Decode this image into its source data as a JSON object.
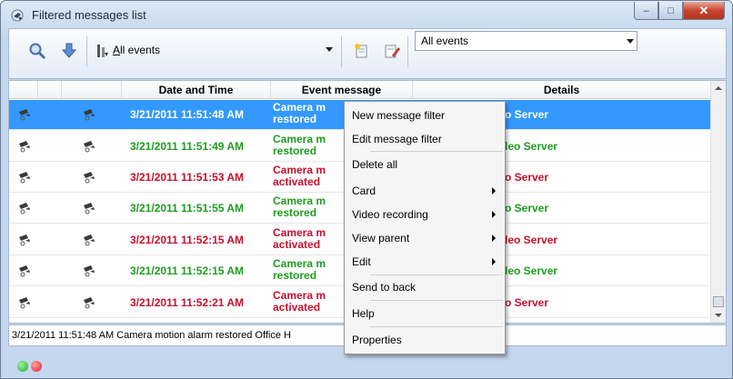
{
  "window": {
    "title": "Filtered messages list",
    "minimize_glyph": "–",
    "maximize_glyph": "□",
    "close_glyph": "✕"
  },
  "toolbar": {
    "events_filter_label_prefix": "",
    "events_filter_label_underlined": "A",
    "events_filter_label_rest": "ll events",
    "combo_value": "All events"
  },
  "grid": {
    "columns": [
      "",
      "",
      "",
      "Date and Time",
      "Event message",
      "Details"
    ],
    "rows": [
      {
        "datetime": "3/21/2011 11:51:48 AM",
        "message_line1": "Camera m",
        "message_line2": "restored",
        "details": "o Server",
        "status": "green",
        "selected": true
      },
      {
        "datetime": "3/21/2011 11:51:49 AM",
        "message_line1": "Camera m",
        "message_line2": "restored",
        "details": "leo Server",
        "status": "green",
        "selected": false
      },
      {
        "datetime": "3/21/2011 11:51:53 AM",
        "message_line1": "Camera m",
        "message_line2": "activated",
        "details": "o Server",
        "status": "red",
        "selected": false
      },
      {
        "datetime": "3/21/2011 11:51:55 AM",
        "message_line1": "Camera m",
        "message_line2": "restored",
        "details": "o Server",
        "status": "green",
        "selected": false
      },
      {
        "datetime": "3/21/2011 11:52:15 AM",
        "message_line1": "Camera m",
        "message_line2": "activated",
        "details": "leo Server",
        "status": "red",
        "selected": false
      },
      {
        "datetime": "3/21/2011 11:52:15 AM",
        "message_line1": "Camera m",
        "message_line2": "restored",
        "details": "leo Server",
        "status": "green",
        "selected": false
      },
      {
        "datetime": "3/21/2011 11:52:21 AM",
        "message_line1": "Camera m",
        "message_line2": "activated",
        "details": "o Server",
        "status": "red",
        "selected": false
      }
    ]
  },
  "status_line": "3/21/2011 11:51:48 AM  Camera motion alarm restored  Office  H",
  "context_menu": {
    "items": [
      {
        "label": "New message filter",
        "submenu": false
      },
      {
        "label": "Edit message filter",
        "submenu": false
      },
      {
        "label": "Delete all",
        "submenu": false
      },
      {
        "label": "Card",
        "submenu": true
      },
      {
        "label": "Video recording",
        "submenu": true
      },
      {
        "label": "View parent",
        "submenu": true
      },
      {
        "label": "Edit",
        "submenu": true
      },
      {
        "label": "Send to back",
        "submenu": false
      },
      {
        "label": "Help",
        "submenu": false
      },
      {
        "label": "Properties",
        "submenu": false
      }
    ]
  },
  "colors": {
    "selected_row": "#3399ff",
    "restored_text": "#1f9d1f",
    "activated_text": "#c8102e",
    "status_green": "#22aa22",
    "status_red": "#dd2222"
  },
  "icons": {
    "title": "camera-icon",
    "search": "magnifier-icon",
    "down": "arrow-down-icon",
    "filter": "filter-icon",
    "new_filter": "new-filter-icon",
    "edit_filter": "edit-filter-icon",
    "row": "camera-icon"
  }
}
